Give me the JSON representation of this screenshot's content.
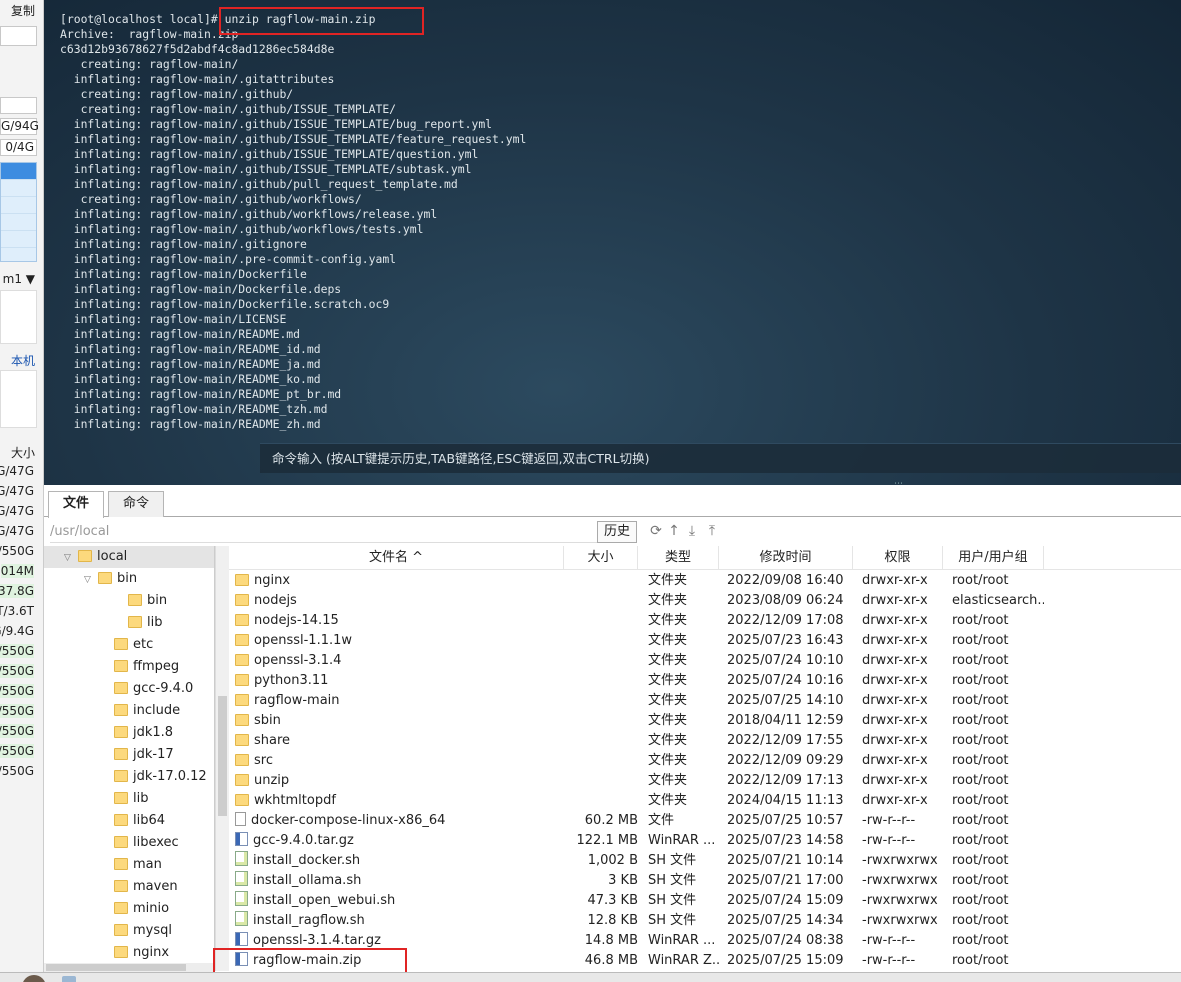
{
  "left_panel": {
    "copy_label": "复制",
    "bar1": "G/94G",
    "bar2": "0/4G",
    "dropdown": "m1 ▼",
    "host_label": "本机",
    "col_size": "大小",
    "sizes": [
      "G/47G",
      "G/47G",
      "G/47G",
      "G/47G",
      "/550G",
      "014M",
      "37.8G",
      "T/3.6T",
      "G/9.4G",
      "/550G",
      "/550G",
      "/550G",
      "/550G",
      "/550G",
      "/550G",
      "/550G"
    ]
  },
  "terminal": {
    "lines": [
      "[root@localhost local]# unzip ragflow-main.zip",
      "Archive:  ragflow-main.zip",
      "c63d12b93678627f5d2abdf4c8ad1286ec584d8e",
      "   creating: ragflow-main/",
      "  inflating: ragflow-main/.gitattributes",
      "   creating: ragflow-main/.github/",
      "   creating: ragflow-main/.github/ISSUE_TEMPLATE/",
      "  inflating: ragflow-main/.github/ISSUE_TEMPLATE/bug_report.yml",
      "  inflating: ragflow-main/.github/ISSUE_TEMPLATE/feature_request.yml",
      "  inflating: ragflow-main/.github/ISSUE_TEMPLATE/question.yml",
      "  inflating: ragflow-main/.github/ISSUE_TEMPLATE/subtask.yml",
      "  inflating: ragflow-main/.github/pull_request_template.md",
      "   creating: ragflow-main/.github/workflows/",
      "  inflating: ragflow-main/.github/workflows/release.yml",
      "  inflating: ragflow-main/.github/workflows/tests.yml",
      "  inflating: ragflow-main/.gitignore",
      "  inflating: ragflow-main/.pre-commit-config.yaml",
      "  inflating: ragflow-main/Dockerfile",
      "  inflating: ragflow-main/Dockerfile.deps",
      "  inflating: ragflow-main/Dockerfile.scratch.oc9",
      "  inflating: ragflow-main/LICENSE",
      "  inflating: ragflow-main/README.md",
      "  inflating: ragflow-main/README_id.md",
      "  inflating: ragflow-main/README_ja.md",
      "  inflating: ragflow-main/README_ko.md",
      "  inflating: ragflow-main/README_pt_br.md",
      "  inflating: ragflow-main/README_tzh.md",
      "  inflating: ragflow-main/README_zh.md"
    ],
    "input_hint": "命令输入 (按ALT键提示历史,TAB键路径,ESC键返回,双击CTRL切换)"
  },
  "tabs": {
    "files": "文件",
    "commands": "命令"
  },
  "pathbar": {
    "path": "/usr/local",
    "history": "历史"
  },
  "tree": [
    {
      "label": "local",
      "arrow": "﹀",
      "selected": true
    },
    {
      "label": "bin",
      "arrow": "﹀"
    },
    {
      "label": "bin"
    },
    {
      "label": "lib"
    },
    {
      "label": "etc"
    },
    {
      "label": "ffmpeg"
    },
    {
      "label": "gcc-9.4.0"
    },
    {
      "label": "include"
    },
    {
      "label": "jdk1.8"
    },
    {
      "label": "jdk-17"
    },
    {
      "label": "jdk-17.0.12"
    },
    {
      "label": "lib"
    },
    {
      "label": "lib64"
    },
    {
      "label": "libexec"
    },
    {
      "label": "man"
    },
    {
      "label": "maven"
    },
    {
      "label": "minio"
    },
    {
      "label": "mysql"
    },
    {
      "label": "nginx"
    }
  ],
  "columns": {
    "name": "文件名 ^",
    "size": "大小",
    "type": "类型",
    "date": "修改时间",
    "perm": "权限",
    "owner": "用户/用户组"
  },
  "files": [
    {
      "name": "nginx",
      "size": "",
      "type": "文件夹",
      "date": "2022/09/08 16:40",
      "perm": "drwxr-xr-x",
      "owner": "root/root",
      "icon": "folder"
    },
    {
      "name": "nodejs",
      "size": "",
      "type": "文件夹",
      "date": "2023/08/09 06:24",
      "perm": "drwxr-xr-x",
      "owner": "elasticsearch...",
      "icon": "folder"
    },
    {
      "name": "nodejs-14.15",
      "size": "",
      "type": "文件夹",
      "date": "2022/12/09 17:08",
      "perm": "drwxr-xr-x",
      "owner": "root/root",
      "icon": "folder"
    },
    {
      "name": "openssl-1.1.1w",
      "size": "",
      "type": "文件夹",
      "date": "2025/07/23 16:43",
      "perm": "drwxr-xr-x",
      "owner": "root/root",
      "icon": "folder"
    },
    {
      "name": "openssl-3.1.4",
      "size": "",
      "type": "文件夹",
      "date": "2025/07/24 10:10",
      "perm": "drwxr-xr-x",
      "owner": "root/root",
      "icon": "folder"
    },
    {
      "name": "python3.11",
      "size": "",
      "type": "文件夹",
      "date": "2025/07/24 10:16",
      "perm": "drwxr-xr-x",
      "owner": "root/root",
      "icon": "folder"
    },
    {
      "name": "ragflow-main",
      "size": "",
      "type": "文件夹",
      "date": "2025/07/25 14:10",
      "perm": "drwxr-xr-x",
      "owner": "root/root",
      "icon": "folder"
    },
    {
      "name": "sbin",
      "size": "",
      "type": "文件夹",
      "date": "2018/04/11 12:59",
      "perm": "drwxr-xr-x",
      "owner": "root/root",
      "icon": "folder"
    },
    {
      "name": "share",
      "size": "",
      "type": "文件夹",
      "date": "2022/12/09 17:55",
      "perm": "drwxr-xr-x",
      "owner": "root/root",
      "icon": "folder"
    },
    {
      "name": "src",
      "size": "",
      "type": "文件夹",
      "date": "2022/12/09 09:29",
      "perm": "drwxr-xr-x",
      "owner": "root/root",
      "icon": "folder"
    },
    {
      "name": "unzip",
      "size": "",
      "type": "文件夹",
      "date": "2022/12/09 17:13",
      "perm": "drwxr-xr-x",
      "owner": "root/root",
      "icon": "folder"
    },
    {
      "name": "wkhtmltopdf",
      "size": "",
      "type": "文件夹",
      "date": "2024/04/15 11:13",
      "perm": "drwxr-xr-x",
      "owner": "root/root",
      "icon": "folder"
    },
    {
      "name": "docker-compose-linux-x86_64",
      "size": "60.2 MB",
      "type": "文件",
      "date": "2025/07/25 10:57",
      "perm": "-rw-r--r--",
      "owner": "root/root",
      "icon": "file"
    },
    {
      "name": "gcc-9.4.0.tar.gz",
      "size": "122.1 MB",
      "type": "WinRAR ...",
      "date": "2025/07/23 14:58",
      "perm": "-rw-r--r--",
      "owner": "root/root",
      "icon": "rar"
    },
    {
      "name": "install_docker.sh",
      "size": "1,002 B",
      "type": "SH 文件",
      "date": "2025/07/21 10:14",
      "perm": "-rwxrwxrwx",
      "owner": "root/root",
      "icon": "sh"
    },
    {
      "name": "install_ollama.sh",
      "size": "3 KB",
      "type": "SH 文件",
      "date": "2025/07/21 17:00",
      "perm": "-rwxrwxrwx",
      "owner": "root/root",
      "icon": "sh"
    },
    {
      "name": "install_open_webui.sh",
      "size": "47.3 KB",
      "type": "SH 文件",
      "date": "2025/07/24 15:09",
      "perm": "-rwxrwxrwx",
      "owner": "root/root",
      "icon": "sh"
    },
    {
      "name": "install_ragflow.sh",
      "size": "12.8 KB",
      "type": "SH 文件",
      "date": "2025/07/25 14:34",
      "perm": "-rwxrwxrwx",
      "owner": "root/root",
      "icon": "sh"
    },
    {
      "name": "openssl-3.1.4.tar.gz",
      "size": "14.8 MB",
      "type": "WinRAR ...",
      "date": "2025/07/24 08:38",
      "perm": "-rw-r--r--",
      "owner": "root/root",
      "icon": "rar"
    },
    {
      "name": "ragflow-main.zip",
      "size": "46.8 MB",
      "type": "WinRAR Z...",
      "date": "2025/07/25 15:09",
      "perm": "-rw-r--r--",
      "owner": "root/root",
      "icon": "rar"
    }
  ]
}
